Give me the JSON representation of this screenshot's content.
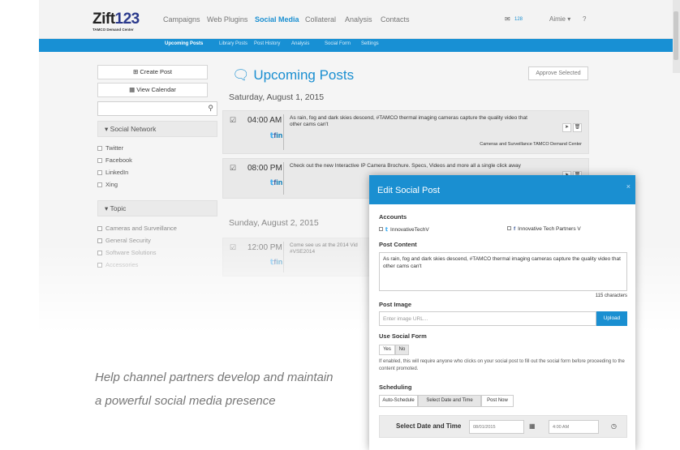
{
  "header": {
    "logo_text": "Zift",
    "logo_num": "123",
    "logo_sub": "TAMCO Demand Center",
    "nav": [
      "Campaigns",
      "Web Plugins",
      "Social Media",
      "Collateral",
      "Analysis",
      "Contacts"
    ],
    "mail_count": "128",
    "user": "Aimie ▾",
    "help": "?"
  },
  "subnav": [
    "Upcoming Posts",
    "Library Posts",
    "Post History",
    "Analysis",
    "Social Form",
    "Settings"
  ],
  "sidebar": {
    "create_post": "Create Post",
    "view_calendar": "View Calendar",
    "social_network_label": "Social Network",
    "networks": [
      "Twitter",
      "Facebook",
      "LinkedIn",
      "Xing"
    ],
    "topic_label": "Topic",
    "topics": [
      "Cameras and Surveillance",
      "General Security",
      "Software Solutions",
      "Accessories"
    ]
  },
  "main": {
    "title": "Upcoming Posts",
    "approve": "Approve Selected",
    "day1": "Saturday, August 1, 2015",
    "posts": [
      {
        "time": "04:00 AM",
        "text": "As rain, fog and dark skies descend, #TAMCO thermal imaging cameras capture the quality video that other cams can't",
        "tags": "Cameras and Surveillance    TAMCO Demand Center"
      },
      {
        "time": "08:00 PM",
        "text": "Check out the new Interactive IP Camera Brochure. Specs, Videos and more all a single click away"
      },
      {
        "time": "12:00 PM",
        "text": "Come see us at the 2014 Vid #VSE2014"
      }
    ],
    "day2": "Sunday, August 2, 2015"
  },
  "tagline": {
    "line1": "Help channel partners develop and maintain",
    "line2": "a powerful social media presence"
  },
  "modal": {
    "title": "Edit Social Post",
    "close": "×",
    "accounts_label": "Accounts",
    "account1": "InnovativeTechV",
    "account2": "Innovative Tech Partners V",
    "content_label": "Post Content",
    "content": "As rain, fog and dark skies descend, #TAMCO thermal imaging cameras capture the quality video that other cams can't",
    "chars": "115 characters",
    "image_label": "Post Image",
    "image_placeholder": "Enter image URL...",
    "upload": "Upload",
    "social_form_label": "Use Social Form",
    "yes": "Yes",
    "no": "No",
    "help": "If enabled, this will require anyone who clicks on your social post to fill out the social form before proceeding to the content promoted.",
    "scheduling_label": "Scheduling",
    "sched_options": [
      "Auto-Schedule",
      "Select Date and Time",
      "Post Now"
    ],
    "date_label": "Select Date and Time",
    "date_value": "08/01/2015",
    "time_value": "4:00 AM"
  }
}
